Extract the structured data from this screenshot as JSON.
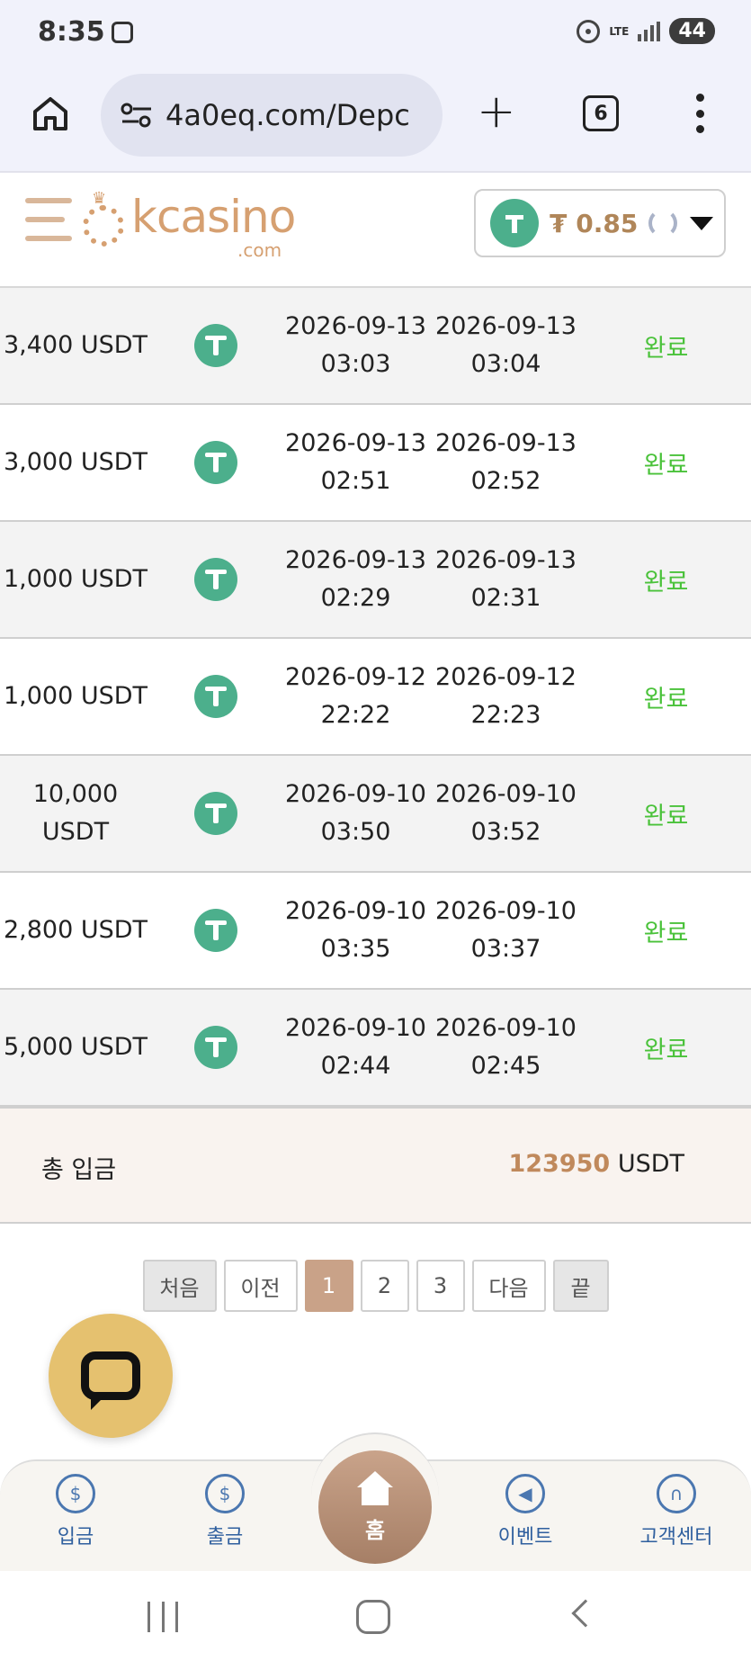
{
  "status_bar": {
    "time": "8:35",
    "network": "LTE",
    "battery": "44"
  },
  "browser": {
    "url": "4a0eq.com/Depc",
    "tab_count": "6"
  },
  "header": {
    "logo_text": "kcasino",
    "logo_sub": ".com",
    "balance": "₮ 0.85"
  },
  "deposits": [
    {
      "amount": "3,400 USDT",
      "requested_date": "2026-09-13",
      "requested_time": "03:03",
      "processed_date": "2026-09-13",
      "processed_time": "03:04",
      "status": "완료"
    },
    {
      "amount": "3,000 USDT",
      "requested_date": "2026-09-13",
      "requested_time": "02:51",
      "processed_date": "2026-09-13",
      "processed_time": "02:52",
      "status": "완료"
    },
    {
      "amount": "1,000 USDT",
      "requested_date": "2026-09-13",
      "requested_time": "02:29",
      "processed_date": "2026-09-13",
      "processed_time": "02:31",
      "status": "완료"
    },
    {
      "amount": "1,000 USDT",
      "requested_date": "2026-09-12",
      "requested_time": "22:22",
      "processed_date": "2026-09-12",
      "processed_time": "22:23",
      "status": "완료"
    },
    {
      "amount_line1": "10,000",
      "amount_line2": "USDT",
      "requested_date": "2026-09-10",
      "requested_time": "03:50",
      "processed_date": "2026-09-10",
      "processed_time": "03:52",
      "status": "완료"
    },
    {
      "amount": "2,800 USDT",
      "requested_date": "2026-09-10",
      "requested_time": "03:35",
      "processed_date": "2026-09-10",
      "processed_time": "03:37",
      "status": "완료"
    },
    {
      "amount": "5,000 USDT",
      "requested_date": "2026-09-10",
      "requested_time": "02:44",
      "processed_date": "2026-09-10",
      "processed_time": "02:45",
      "status": "완료"
    }
  ],
  "total": {
    "label": "총 입금",
    "value": "123950",
    "unit": "USDT"
  },
  "pagination": {
    "first": "처음",
    "prev": "이전",
    "pages": [
      "1",
      "2",
      "3"
    ],
    "next": "다음",
    "last": "끝"
  },
  "bottom_nav": {
    "deposit": "입금",
    "withdraw": "출금",
    "home": "홈",
    "event": "이벤트",
    "support": "고객센터"
  },
  "colors": {
    "accent": "#c9a288",
    "tether": "#4caf8c",
    "status_done": "#4ac23a"
  }
}
